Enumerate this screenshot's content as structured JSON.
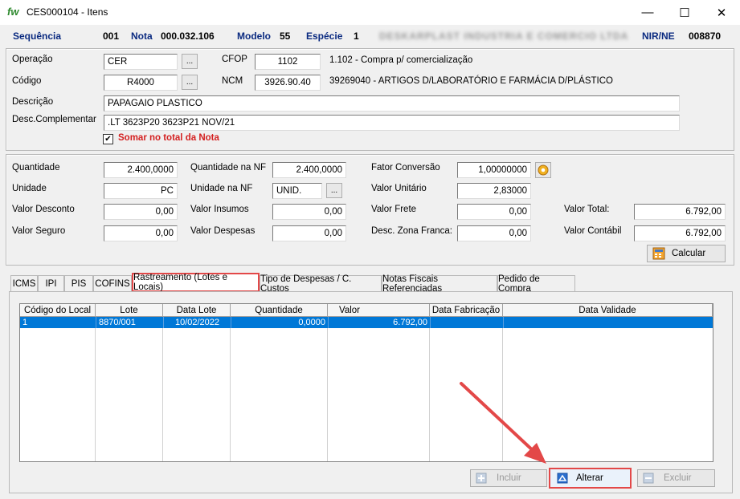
{
  "window": {
    "logo": "fw",
    "title": "CES000104 - Itens",
    "minimize": "—",
    "maximize": "☐",
    "close": "✕"
  },
  "header": {
    "sequencia_label": "Sequência",
    "sequencia": "001",
    "nota_label": "Nota",
    "nota": "000.032.106",
    "modelo_label": "Modelo",
    "modelo": "55",
    "especie_label": "Espécie",
    "especie": "1",
    "supplier": "DESKARPLAST INDUSTRIA E COMERCIO LTDA",
    "nir_label": "NIR/NE",
    "nir": "008870"
  },
  "product": {
    "operacao_label": "Operação",
    "operacao": "CER",
    "cfop_label": "CFOP",
    "cfop": "1102",
    "cfop_desc": "1.102 - Compra p/ comercialização",
    "codigo_label": "Código",
    "codigo": "R4000",
    "ncm_label": "NCM",
    "ncm": "3926.90.40",
    "ncm_desc": "39269040 - ARTIGOS D/LABORATÓRIO E FARMÁCIA D/PLÁSTICO",
    "descricao_label": "Descrição",
    "descricao": "PAPAGAIO PLASTICO",
    "desc_comp_label": "Desc.Complementar",
    "desc_comp": ".LT 3623P20 3623P21 NOV/21",
    "somar_label": "Somar no total da Nota",
    "somar_checked": "✔",
    "lookup_btn": "..."
  },
  "values": {
    "quantidade_label": "Quantidade",
    "quantidade": "2.400,0000",
    "qtd_nf_label": "Quantidade na NF",
    "qtd_nf": "2.400,0000",
    "fator_label": "Fator Conversão",
    "fator": "1,00000000",
    "unidade_label": "Unidade",
    "unidade": "PC",
    "unid_nf_label": "Unidade na NF",
    "unid_nf": "UNID.",
    "valor_unit_label": "Valor Unitário",
    "valor_unit": "2,83000",
    "valor_desconto_label": "Valor Desconto",
    "valor_desconto": "0,00",
    "valor_insumos_label": "Valor Insumos",
    "valor_insumos": "0,00",
    "valor_frete_label": "Valor Frete",
    "valor_frete": "0,00",
    "valor_total_label": "Valor Total:",
    "valor_total": "6.792,00",
    "valor_seguro_label": "Valor Seguro",
    "valor_seguro": "0,00",
    "valor_despesas_label": "Valor Despesas",
    "valor_despesas": "0,00",
    "desc_zona_label": "Desc. Zona Franca:",
    "desc_zona": "0,00",
    "valor_contabil_label": "Valor Contábil",
    "valor_contabil": "6.792,00",
    "calcular_label": "Calcular"
  },
  "tabs": [
    "ICMS",
    "IPI",
    "PIS",
    "COFINS",
    "Rastreamento (Lotes e Locais)",
    "Tipo de Despesas / C. Custos",
    "Notas Fiscais Referenciadas",
    "Pedido de Compra"
  ],
  "grid": {
    "columns": [
      "Código do Local",
      "Lote",
      "Data Lote",
      "Quantidade",
      "Valor",
      "Data Fabricação",
      "Data Validade"
    ],
    "rows": [
      [
        "1",
        "8870/001",
        "10/02/2022",
        "0,0000",
        "6.792,00",
        "",
        ""
      ]
    ]
  },
  "actions": {
    "incluir": "Incluir",
    "alterar": "Alterar",
    "excluir": "Excluir"
  },
  "colors": {
    "accent": "#0a2a80",
    "highlight": "#e34848",
    "selection": "#0078d7"
  }
}
